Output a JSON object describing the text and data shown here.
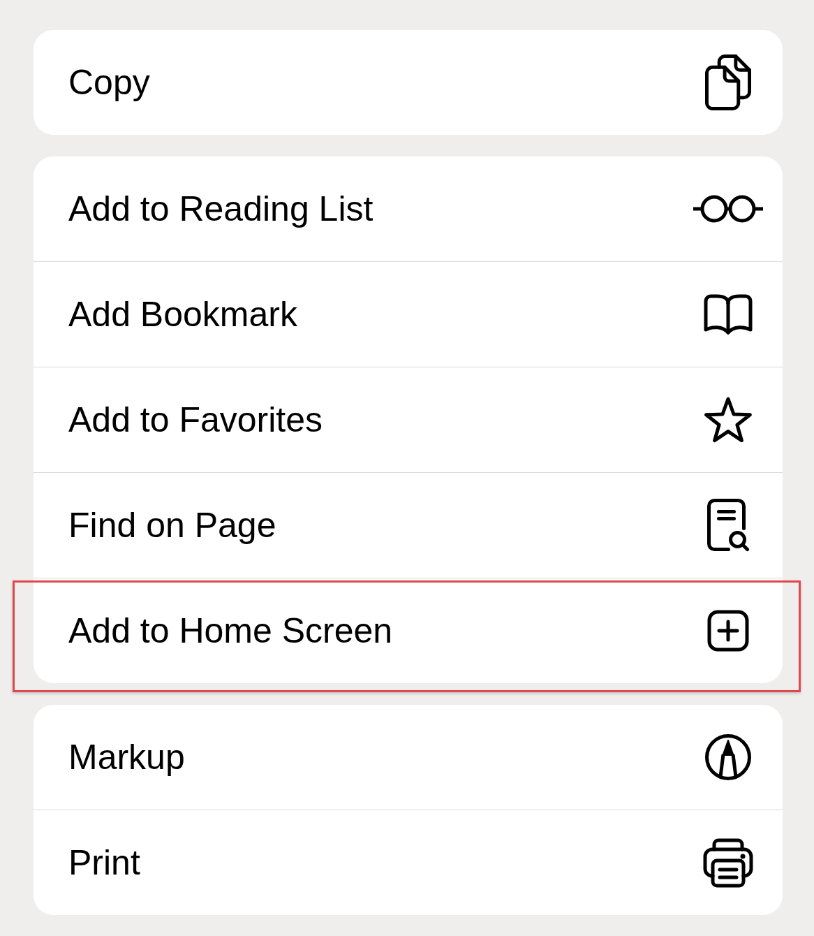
{
  "groups": [
    {
      "items": [
        {
          "label": "Copy",
          "highlighted": false
        }
      ]
    },
    {
      "items": [
        {
          "label": "Add to Reading List",
          "highlighted": false
        },
        {
          "label": "Add Bookmark",
          "highlighted": false
        },
        {
          "label": "Add to Favorites",
          "highlighted": false
        },
        {
          "label": "Find on Page",
          "highlighted": false
        },
        {
          "label": "Add to Home Screen",
          "highlighted": true
        }
      ]
    },
    {
      "items": [
        {
          "label": "Markup",
          "highlighted": false
        },
        {
          "label": "Print",
          "highlighted": false
        }
      ]
    }
  ]
}
